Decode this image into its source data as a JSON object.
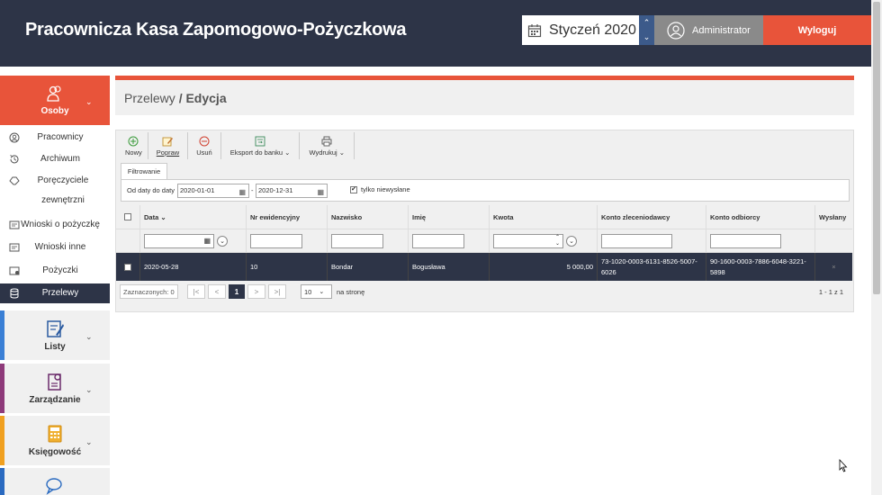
{
  "header": {
    "app_title": "Pracownicza Kasa Zapomogowo-Pożyczkowa",
    "month": "Styczeń 2020",
    "user": "Administrator",
    "logout_label": "Wyloguj"
  },
  "sidebar": {
    "osoby_label": "Osoby",
    "items": [
      {
        "label": "Pracownicy"
      },
      {
        "label": "Archiwum"
      },
      {
        "label": "Poręczyciele zewnętrzni"
      },
      {
        "label": "Wnioski o pożyczkę"
      },
      {
        "label": "Wnioski inne"
      },
      {
        "label": "Pożyczki"
      },
      {
        "label": "Przelewy"
      }
    ],
    "sections": [
      {
        "label": "Listy",
        "color": "#3a7fd5"
      },
      {
        "label": "Zarządzanie",
        "color": "#8e3a7a"
      },
      {
        "label": "Księgowość",
        "color": "#f0a020"
      },
      {
        "label": "",
        "color": "#2a6ac0"
      }
    ]
  },
  "breadcrumb": {
    "parent": "Przelewy",
    "separator": "/",
    "current": "Edycja"
  },
  "toolbar": {
    "new_label": "Nowy",
    "edit_label": "Popraw",
    "delete_label": "Usuń",
    "export_label": "Eksport do banku",
    "print_label": "Wydrukuj"
  },
  "filter": {
    "tab_label": "Filtrowanie",
    "date_label": "Od daty do daty",
    "date_from": "2020-01-01",
    "date_to": "2020-12-31",
    "dash": "-",
    "unsent_label": "tylko niewysłane",
    "unsent_checked": "✔"
  },
  "table": {
    "columns": [
      "Data",
      "Nr ewidencyjny",
      "Nazwisko",
      "Imię",
      "Kwota",
      "Konto zleceniodawcy",
      "Konto odbiorcy",
      "Wysłany"
    ],
    "rows": [
      {
        "data": "2020-05-28",
        "nr": "10",
        "nazwisko": "Bondar",
        "imie": "Bogusława",
        "kwota": "5 000,00",
        "konto_zlec": "73-1020-0003-6131-8526-5007-6026",
        "konto_odb": "90-1600-0003-7886-6048-3221-5898",
        "wyslany": "×"
      }
    ]
  },
  "pager": {
    "selected": "Zaznaczonych: 0",
    "page": "1",
    "per_page": "10",
    "per_page_label": "na stronę",
    "range": "1 - 1 z 1"
  }
}
